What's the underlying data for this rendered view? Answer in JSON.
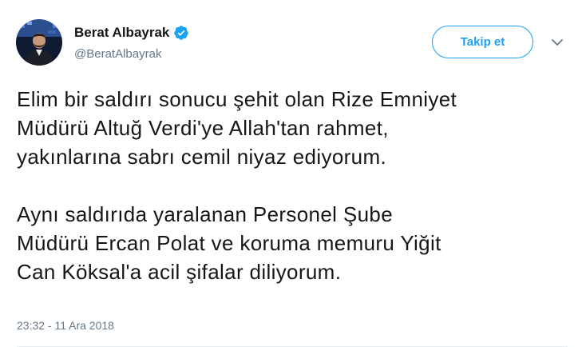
{
  "author": {
    "display_name": "Berat Albayrak",
    "username": "@BeratAlbayrak",
    "verified": true
  },
  "follow_button": {
    "label": "Takip et"
  },
  "more_menu": {
    "icon": "chevron-down-icon"
  },
  "tweet": {
    "paragraphs": [
      "Elim bir saldırı sonucu şehit olan Rize Emniyet\nMüdürü Altuğ Verdi'ye Allah'tan rahmet,\nyakınlarına sabrı cemil niyaz ediyorum.",
      "Aynı saldırıda yaralanan Personel Şube\nMüdürü Ercan Polat ve koruma memuru Yiğit\nCan Köksal'a acil şifalar diliyorum."
    ],
    "timestamp": "23:32 - 11 Ara 2018"
  },
  "colors": {
    "accent": "#1da1f2",
    "text_primary": "#14171a",
    "text_secondary": "#657786",
    "divider": "#e6ecf0"
  }
}
